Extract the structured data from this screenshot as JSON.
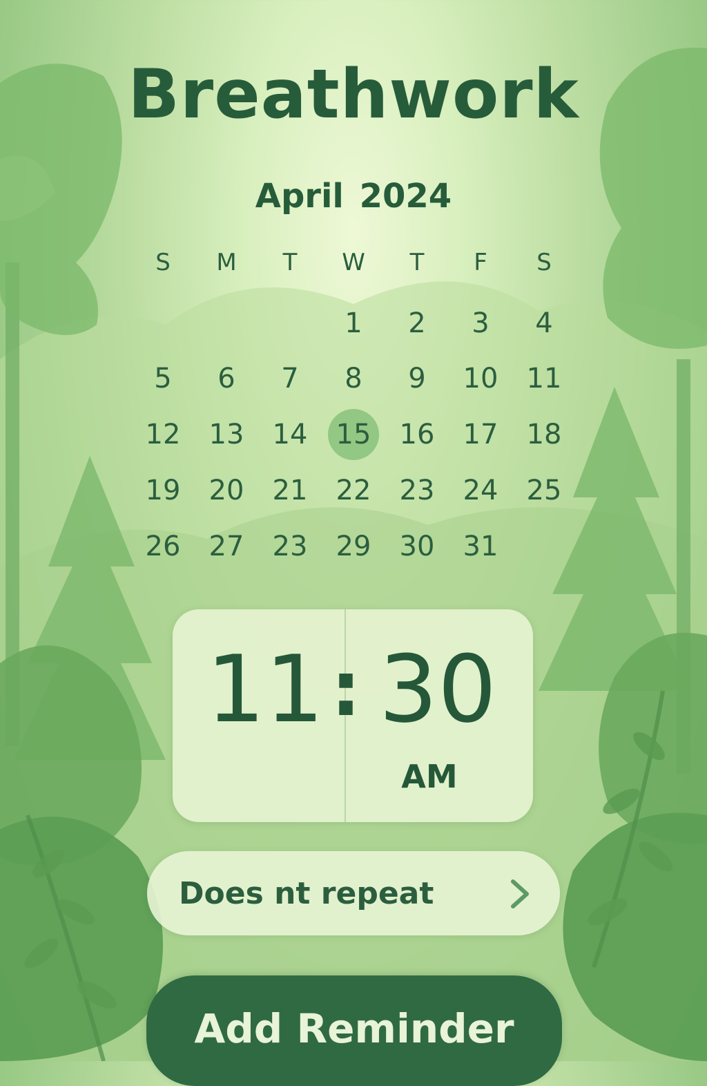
{
  "app": {
    "title": "Breathwork"
  },
  "calendar": {
    "month_label": "April 2024",
    "weekdays": [
      "S",
      "M",
      "T",
      "W",
      "T",
      "F",
      "S"
    ],
    "weeks": [
      [
        "",
        "",
        "",
        "1",
        "2",
        "3",
        "4"
      ],
      [
        "5",
        "6",
        "7",
        "8",
        "9",
        "10",
        "11"
      ],
      [
        "12",
        "13",
        "14",
        "15",
        "16",
        "17",
        "18"
      ],
      [
        "19",
        "20",
        "21",
        "22",
        "23",
        "24",
        "25"
      ],
      [
        "26",
        "27",
        "23",
        "29",
        "30",
        "31",
        ""
      ]
    ],
    "selected_day": "15"
  },
  "time": {
    "hour": "11",
    "separator": ":",
    "minute": "30",
    "period": "AM"
  },
  "repeat": {
    "label": "Does nt repeat",
    "icon": "chevron-right-icon"
  },
  "actions": {
    "add_reminder": "Add Reminder"
  },
  "colors": {
    "text": "#275c3b",
    "selected_circle": "#8dc380",
    "button": "#2f6a42",
    "button_text": "#e8f3d7",
    "card": "#e7f4d2"
  }
}
